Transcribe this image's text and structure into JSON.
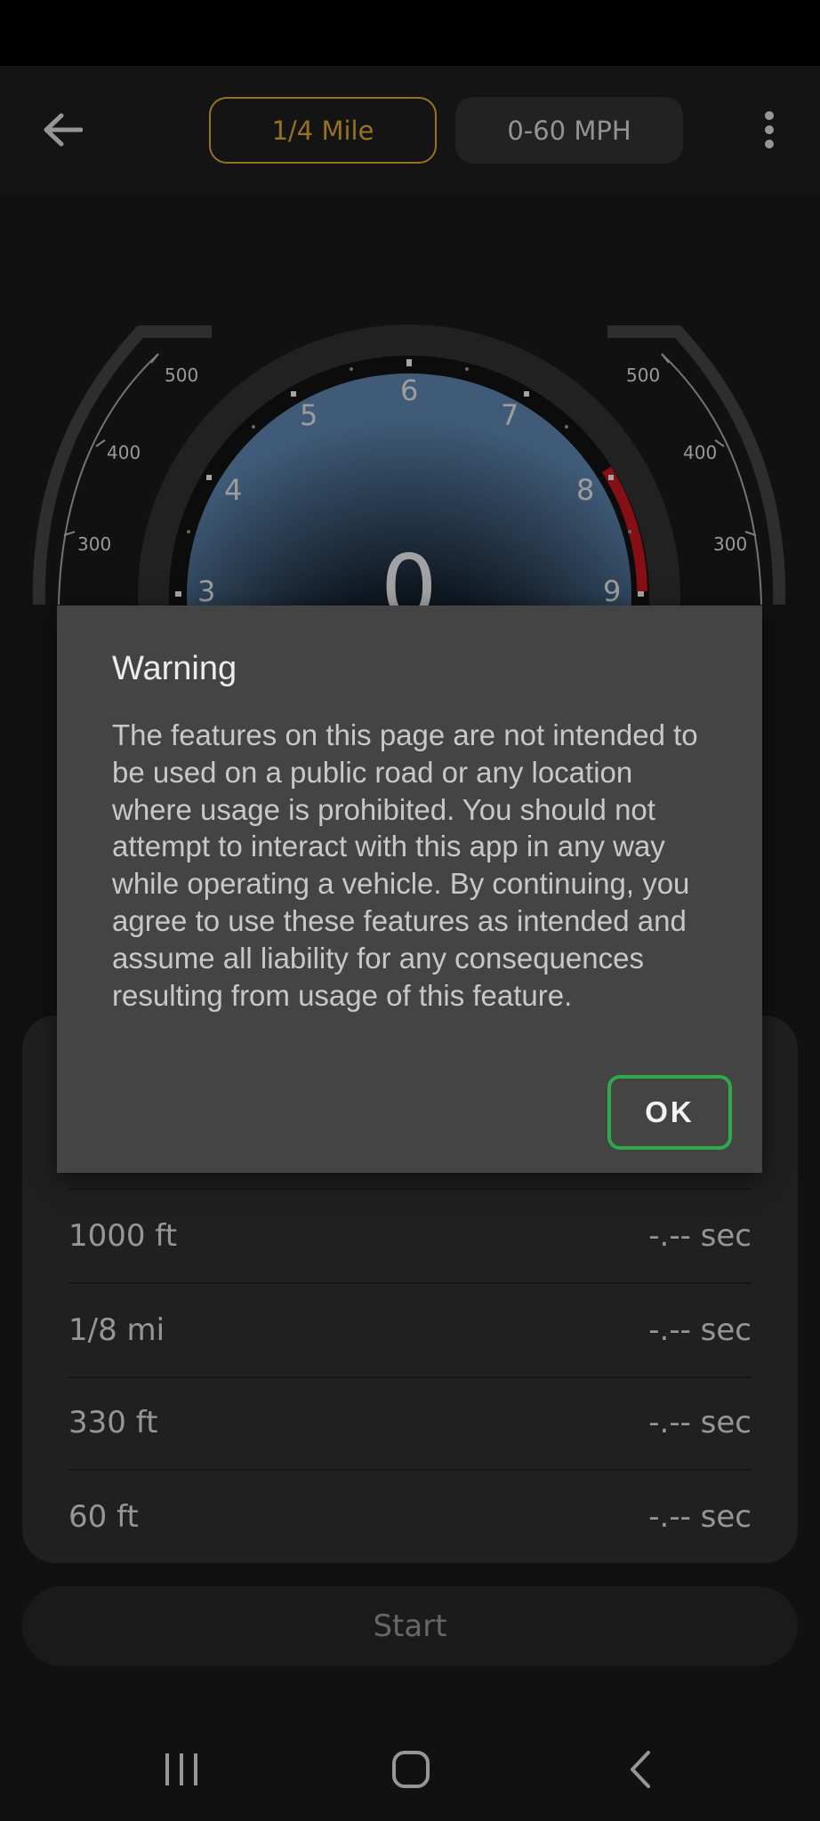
{
  "header": {
    "tabs": [
      {
        "label": "1/4 Mile",
        "active": true
      },
      {
        "label": "0-60 MPH",
        "active": false
      }
    ]
  },
  "gauge": {
    "speed": "0",
    "tach_numbers": [
      "3",
      "4",
      "5",
      "6",
      "7",
      "8",
      "9"
    ],
    "side_scale": [
      "300",
      "400",
      "500"
    ],
    "redline_color": "#b3141c",
    "face_color": "#4a6d91"
  },
  "results": [
    {
      "label": "1000 ft",
      "value": "-.-- sec"
    },
    {
      "label": "1/8 mi",
      "value": "-.-- sec"
    },
    {
      "label": "330 ft",
      "value": "-.-- sec"
    },
    {
      "label": "60 ft",
      "value": "-.-- sec"
    }
  ],
  "start_label": "Start",
  "dialog": {
    "title": "Warning",
    "body": "The features on this page are not intended to be used on a public road or any location where usage is prohibited. You should not attempt to interact with this app in any way while operating a vehicle. By continuing, you agree to use these features as intended and assume all liability for any consequences resulting from usage of this feature.",
    "ok_label": "OK",
    "ok_border_color": "#2eaa4b"
  },
  "icons": {
    "back": "arrow-left-icon",
    "menu": "more-vertical-icon",
    "nav_recents": "recents-icon",
    "nav_home": "home-icon",
    "nav_back": "chevron-left-icon"
  }
}
